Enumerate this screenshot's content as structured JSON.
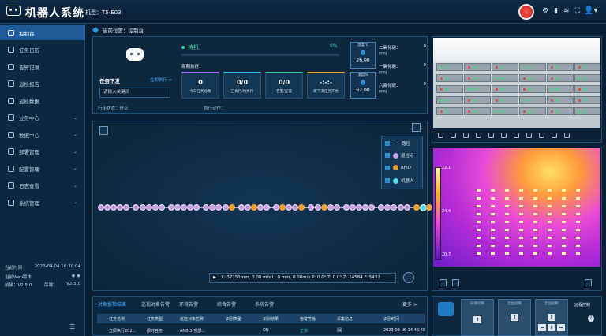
{
  "header": {
    "app_title": "机器人系统",
    "model_label": "机型：",
    "model_value": "T5-E03"
  },
  "sidebar": {
    "items": [
      {
        "label": "控制台",
        "active": true,
        "chevron": false
      },
      {
        "label": "任务日历",
        "active": false,
        "chevron": false
      },
      {
        "label": "告警记录",
        "active": false,
        "chevron": false
      },
      {
        "label": "巡检报告",
        "active": false,
        "chevron": false
      },
      {
        "label": "巡检数据",
        "active": false,
        "chevron": false
      },
      {
        "label": "业务中心",
        "active": false,
        "chevron": true
      },
      {
        "label": "数据中心",
        "active": false,
        "chevron": true
      },
      {
        "label": "部署管理",
        "active": false,
        "chevron": true
      },
      {
        "label": "配置管理",
        "active": false,
        "chevron": true
      },
      {
        "label": "日志查看",
        "active": false,
        "chevron": true
      },
      {
        "label": "系统管理",
        "active": false,
        "chevron": true
      }
    ],
    "info": {
      "time_label": "当前时间",
      "time_value": "2023-04-04 16:30:04",
      "version_label": "当前Web版本",
      "frontend_label": "前端：",
      "frontend_value": "V2.5.0",
      "backend_label": "后端：",
      "backend_value": "V2.5.0"
    }
  },
  "breadcrumb": {
    "prefix": "当前位置：",
    "page": "控制台"
  },
  "task": {
    "issue_label": "任务下发",
    "exec_link": "立即执行 >",
    "keyword_placeholder": "请输入关键词",
    "status_label": "行走状态：",
    "status_value": "停止",
    "exec_label": "执行动作："
  },
  "progress": {
    "state": "待机",
    "percent_text": "0%",
    "percent": 0,
    "cycle_label": "周期执行："
  },
  "stats": [
    {
      "value": "0",
      "label": "今日任务总数"
    },
    {
      "value": "0/0",
      "label": "已执行/待执行"
    },
    {
      "value": "0/0",
      "label": "告警/正常"
    },
    {
      "value": "-:-:-",
      "label": "距下次任务开始"
    }
  ],
  "sensors": {
    "temperature_label": "温度℃",
    "temperature_value": "26.00",
    "humidity_label": "湿度%",
    "humidity_value": "62.00",
    "gases": [
      {
        "name": "二氧化碳：",
        "value": "0",
        "unit": "PPM"
      },
      {
        "name": "一氧化碳：",
        "value": "0",
        "unit": "PPM"
      },
      {
        "name": "六氟化硫：",
        "value": "0",
        "unit": "PPM"
      }
    ]
  },
  "map": {
    "legend": [
      {
        "label": "路径",
        "type": "line"
      },
      {
        "label": "巡检点",
        "type": "dot",
        "color": "#c9a0e6"
      },
      {
        "label": "RFID",
        "type": "dot",
        "color": "#f0a030"
      },
      {
        "label": "机器人",
        "type": "dot",
        "color": "#4ee0f0"
      }
    ],
    "coords": "X: 37151mm,  0.00 m/s   L: 0 mm,  0.00m/s   P: 0.0°   T: 0.0°   Z: 14584   F: 5432"
  },
  "thermal": {
    "max": "22.1",
    "mid": "24.4",
    "min": "20.7"
  },
  "alerts": {
    "tabs": [
      "对象报检结果",
      "巡视对象告警",
      "环境告警",
      "综合告警",
      "系统告警"
    ],
    "more": "更多 >",
    "columns": [
      "任务名称",
      "任务类型",
      "巡检对象名称",
      "识别类型",
      "识别结果",
      "告警等级",
      "采集信息",
      "识别时间"
    ],
    "rows": [
      [
        "立即执行202...",
        "即时任务",
        "AN8-3-顶部...",
        "",
        "ON",
        "正常",
        "",
        "2023-03-06 14:46:48"
      ]
    ]
  },
  "control": {
    "boxes": [
      "升降控制",
      "云台控制",
      "云台控制"
    ],
    "remote_label": "远程控制",
    "help": "?"
  },
  "colors": {
    "accent": "#1d5c99",
    "success": "#3bd0a0",
    "link": "#4fb0ff",
    "background": "#0a1f33"
  }
}
